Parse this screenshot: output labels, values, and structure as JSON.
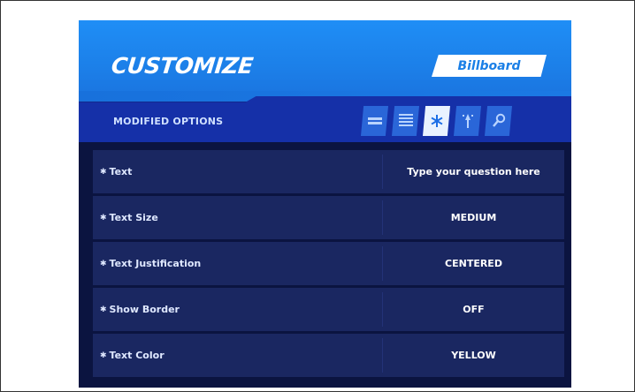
{
  "header": {
    "title": "CUSTOMIZE",
    "item_name": "Billboard"
  },
  "subheader": {
    "label": "MODIFIED OPTIONS",
    "tabs": [
      {
        "icon": "equals-icon",
        "active": false
      },
      {
        "icon": "list-icon",
        "active": false
      },
      {
        "icon": "asterisk-icon",
        "active": true
      },
      {
        "icon": "tree-icon",
        "active": false
      },
      {
        "icon": "search-icon",
        "active": false
      }
    ]
  },
  "options": [
    {
      "label": "Text",
      "value": "Type your question here"
    },
    {
      "label": "Text Size",
      "value": "MEDIUM"
    },
    {
      "label": "Text Justification",
      "value": "CENTERED"
    },
    {
      "label": "Show Border",
      "value": "OFF"
    },
    {
      "label": "Text Color",
      "value": "YELLOW"
    }
  ],
  "colors": {
    "header_blue": "#1f8ef6",
    "subbar_blue": "#1530a8",
    "panel_bg": "#0b1440",
    "row_bg": "#1a2761",
    "tab_blue": "#2a66d8"
  }
}
